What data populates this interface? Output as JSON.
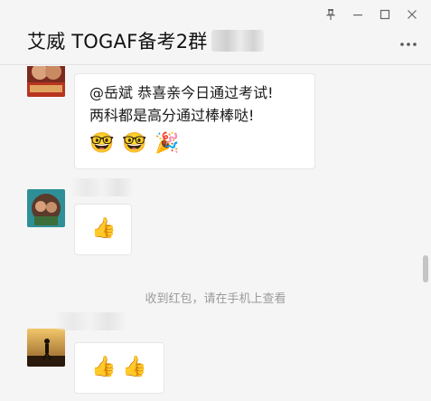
{
  "window": {
    "title": "艾威 TOGAF备考2群",
    "controls": [
      "pin-icon",
      "minimize-icon",
      "maximize-icon",
      "close-icon"
    ],
    "more_icon": "more-dots-icon"
  },
  "messages": [
    {
      "type": "text",
      "avatar": "avatar-1",
      "lines": [
        "@岳斌 恭喜亲今日通过考试!",
        "两科都是高分通过棒棒哒!"
      ],
      "emojis": [
        "🤓",
        "🤓",
        "🎉"
      ],
      "emoji_names": [
        "show-off-666-emoji",
        "show-off-666-emoji",
        "party-popper-emoji"
      ]
    },
    {
      "type": "emoji",
      "avatar": "avatar-2",
      "emojis": [
        "👍"
      ]
    },
    {
      "type": "system",
      "text": "收到红包，请在手机上查看"
    },
    {
      "type": "emoji",
      "avatar": "avatar-3",
      "emojis": [
        "👍",
        "👍"
      ]
    }
  ],
  "colors": {
    "background": "#f5f5f5",
    "bubble": "#ffffff",
    "system_text": "#9b9b9b"
  }
}
